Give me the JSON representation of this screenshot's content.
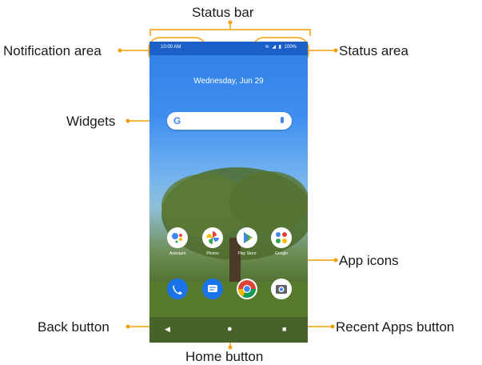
{
  "callouts": {
    "status_bar": "Status bar",
    "notification_area": "Notification area",
    "status_area": "Status area",
    "widgets": "Widgets",
    "app_icons": "App icons",
    "back_button": "Back button",
    "home_button": "Home button",
    "recent_apps_button": "Recent Apps button"
  },
  "phone": {
    "time": "10:00 AM",
    "battery": "100%",
    "date": "Wednesday, Jun 29",
    "search_logo": "G"
  },
  "apps": [
    {
      "label": "Assistant",
      "icon": "assistant-icon"
    },
    {
      "label": "Photos",
      "icon": "photos-icon"
    },
    {
      "label": "Play Store",
      "icon": "play-store-icon"
    },
    {
      "label": "Google",
      "icon": "google-folder-icon"
    }
  ],
  "dock": [
    {
      "icon": "phone-icon"
    },
    {
      "icon": "messages-icon"
    },
    {
      "icon": "chrome-icon"
    },
    {
      "icon": "camera-icon"
    }
  ],
  "colors": {
    "accent": "#f2a007",
    "status_bar": "#1d5fc8"
  }
}
